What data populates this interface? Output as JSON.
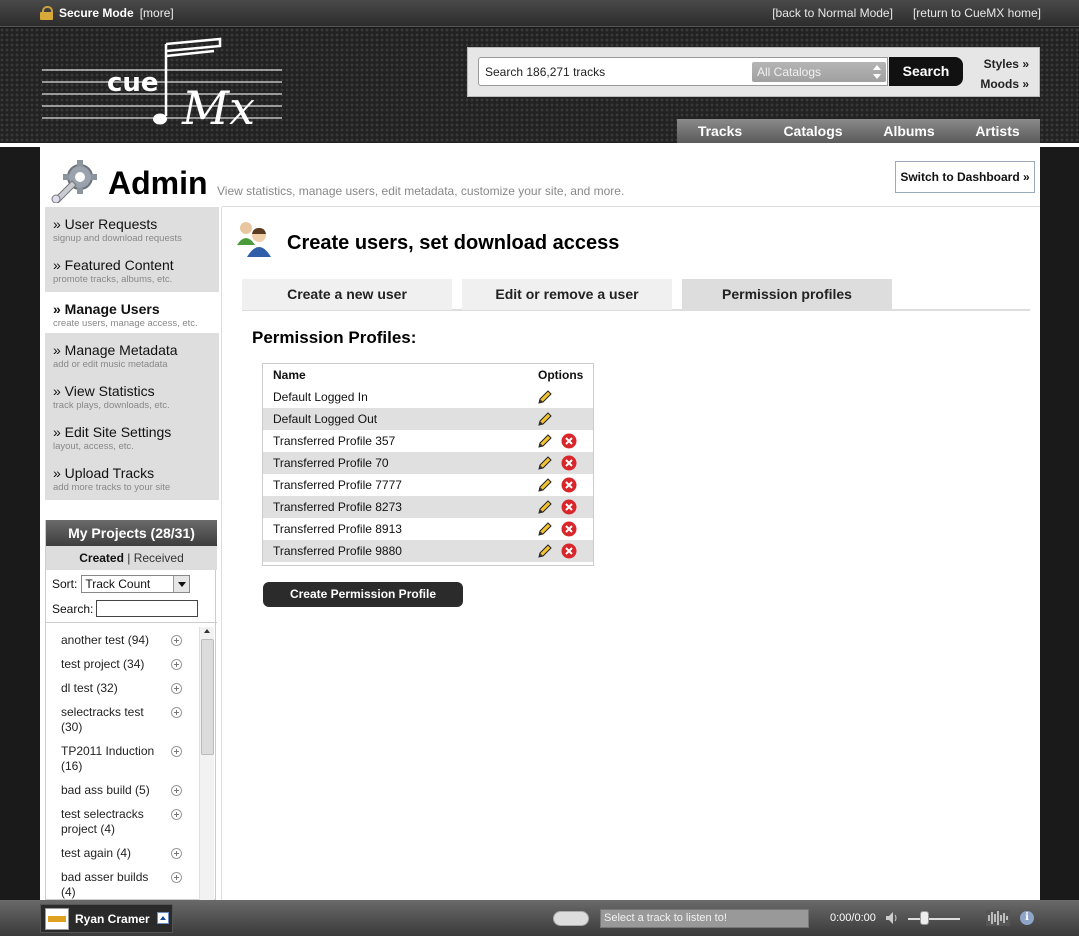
{
  "secure_bar": {
    "mode_label": "Secure Mode",
    "more_link": "[more]",
    "back_link": "[back to Normal Mode]",
    "home_link": "[return to CueMX home]"
  },
  "header": {
    "logo_text_cue": "cue",
    "logo_text_mx": "Mx",
    "search": {
      "value": "Search 186,271 tracks",
      "catalog": "All Catalogs",
      "button": "Search"
    },
    "styles_link": "Styles »",
    "moods_link": "Moods »",
    "nav": [
      "Tracks",
      "Catalogs",
      "Albums",
      "Artists"
    ]
  },
  "admin": {
    "title": "Admin",
    "subtitle": "View statistics, manage users, edit metadata, customize your site, and more.",
    "dashboard_button": "Switch to Dashboard »"
  },
  "menu": [
    {
      "title": "» User Requests",
      "sub": "signup and download requests"
    },
    {
      "title": "» Featured Content",
      "sub": "promote tracks, albums, etc."
    },
    {
      "title": "» Manage Users",
      "sub": "create users, manage access, etc."
    },
    {
      "title": "» Manage Metadata",
      "sub": "add or edit music metadata"
    },
    {
      "title": "» View Statistics",
      "sub": "track plays, downloads, etc."
    },
    {
      "title": "» Edit Site Settings",
      "sub": "layout, access, etc."
    },
    {
      "title": "» Upload Tracks",
      "sub": "add more tracks to your site"
    }
  ],
  "projects": {
    "title": "My Projects (28/31)",
    "tab_created": "Created",
    "tab_sep": " | ",
    "tab_received": "Received",
    "sort_label": "Sort:",
    "sort_value": "Track Count",
    "search_label": "Search:",
    "items": [
      {
        "line1": "another test (94)",
        "line2": ""
      },
      {
        "line1": "test project (34)",
        "line2": ""
      },
      {
        "line1": "dl test (32)",
        "line2": ""
      },
      {
        "line1": "selectracks test",
        "line2": "(30)"
      },
      {
        "line1": "TP2011 Induction",
        "line2": "(16)"
      },
      {
        "line1": "bad ass build (5)",
        "line2": ""
      },
      {
        "line1": "test selectracks",
        "line2": "project (4)"
      },
      {
        "line1": "test again (4)",
        "line2": ""
      },
      {
        "line1": "bad asser builds",
        "line2": "(4)"
      }
    ]
  },
  "content": {
    "title": "Create users, set download access",
    "tabs": [
      "Create a new user",
      "Edit or remove a user",
      "Permission profiles"
    ],
    "section_title": "Permission Profiles:",
    "table_headers": {
      "name": "Name",
      "options": "Options"
    },
    "profiles": [
      {
        "name": "Default Logged In",
        "deletable": false
      },
      {
        "name": "Default Logged Out",
        "deletable": false
      },
      {
        "name": "Transferred Profile 357",
        "deletable": true
      },
      {
        "name": "Transferred Profile 70",
        "deletable": true
      },
      {
        "name": "Transferred Profile 7777",
        "deletable": true
      },
      {
        "name": "Transferred Profile 8273",
        "deletable": true
      },
      {
        "name": "Transferred Profile 8913",
        "deletable": true
      },
      {
        "name": "Transferred Profile 9880",
        "deletable": true
      }
    ],
    "create_button": "Create Permission Profile"
  },
  "player": {
    "user_name": "Ryan Cramer",
    "track_placeholder": "Select a track to listen to!",
    "time": "0:00/0:00"
  },
  "colors": {
    "accent_dark": "#2b2b2b",
    "delete_red": "#d9262a",
    "row_alt": "#e0e0e0"
  }
}
